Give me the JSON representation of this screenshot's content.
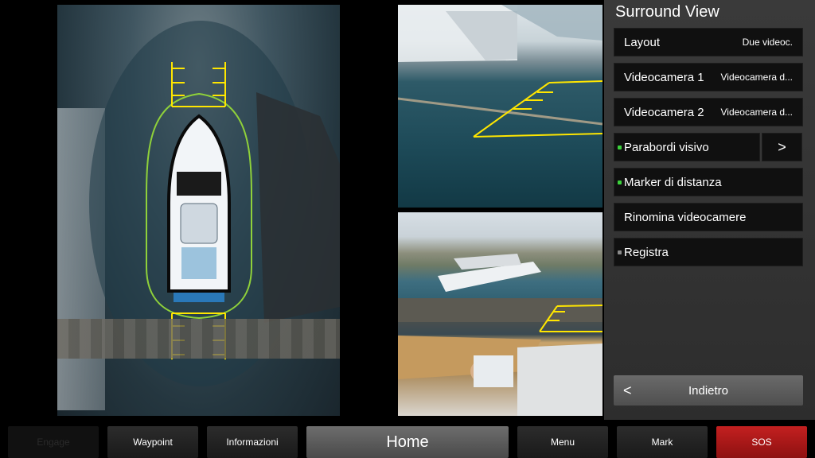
{
  "panel": {
    "title": "Surround View",
    "rows": [
      {
        "label": "Layout",
        "value": "Due videoc."
      },
      {
        "label": "Videocamera 1",
        "value": "Videocamera d..."
      },
      {
        "label": "Videocamera 2",
        "value": "Videocamera d..."
      },
      {
        "label": "Parabordi visivo",
        "indicator": "green"
      },
      {
        "label": "Marker di distanza",
        "indicator": "green"
      },
      {
        "label": "Rinomina videocamere"
      },
      {
        "label": "Registra",
        "indicator": "grey"
      }
    ],
    "arrow": ">",
    "back": {
      "icon": "<",
      "label": "Indietro"
    }
  },
  "bottom": {
    "engage": "Engage",
    "waypoint": "Waypoint",
    "info": "Informazioni",
    "home": "Home",
    "menu": "Menu",
    "mark": "Mark",
    "sos": "SOS"
  },
  "colors": {
    "guide_yellow": "#ffe600",
    "fender_green": "#8fd13a",
    "sos_red": "#c32020"
  }
}
